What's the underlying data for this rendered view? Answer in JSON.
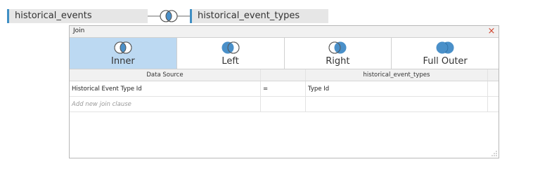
{
  "canvas": {
    "left_table": "historical_events",
    "right_table": "historical_event_types"
  },
  "dialog": {
    "title": "Join",
    "close_glyph": "×",
    "join_types": [
      {
        "label": "Inner",
        "icon": "inner-join-icon",
        "selected": true
      },
      {
        "label": "Left",
        "icon": "left-join-icon",
        "selected": false
      },
      {
        "label": "Right",
        "icon": "right-join-icon",
        "selected": false
      },
      {
        "label": "Full Outer",
        "icon": "full-outer-join-icon",
        "selected": false
      }
    ],
    "columns": {
      "left": "Data Source",
      "operator": "",
      "right": "historical_event_types"
    },
    "clauses": [
      {
        "left": "Historical Event Type Id",
        "operator": "=",
        "right": "Type Id"
      }
    ],
    "add_clause_placeholder": "Add new join clause"
  },
  "colors": {
    "accent": "#3f8fc4",
    "venn_fill": "#4a90c9",
    "selected_bg": "#bcd9f2",
    "close": "#d0452f"
  }
}
